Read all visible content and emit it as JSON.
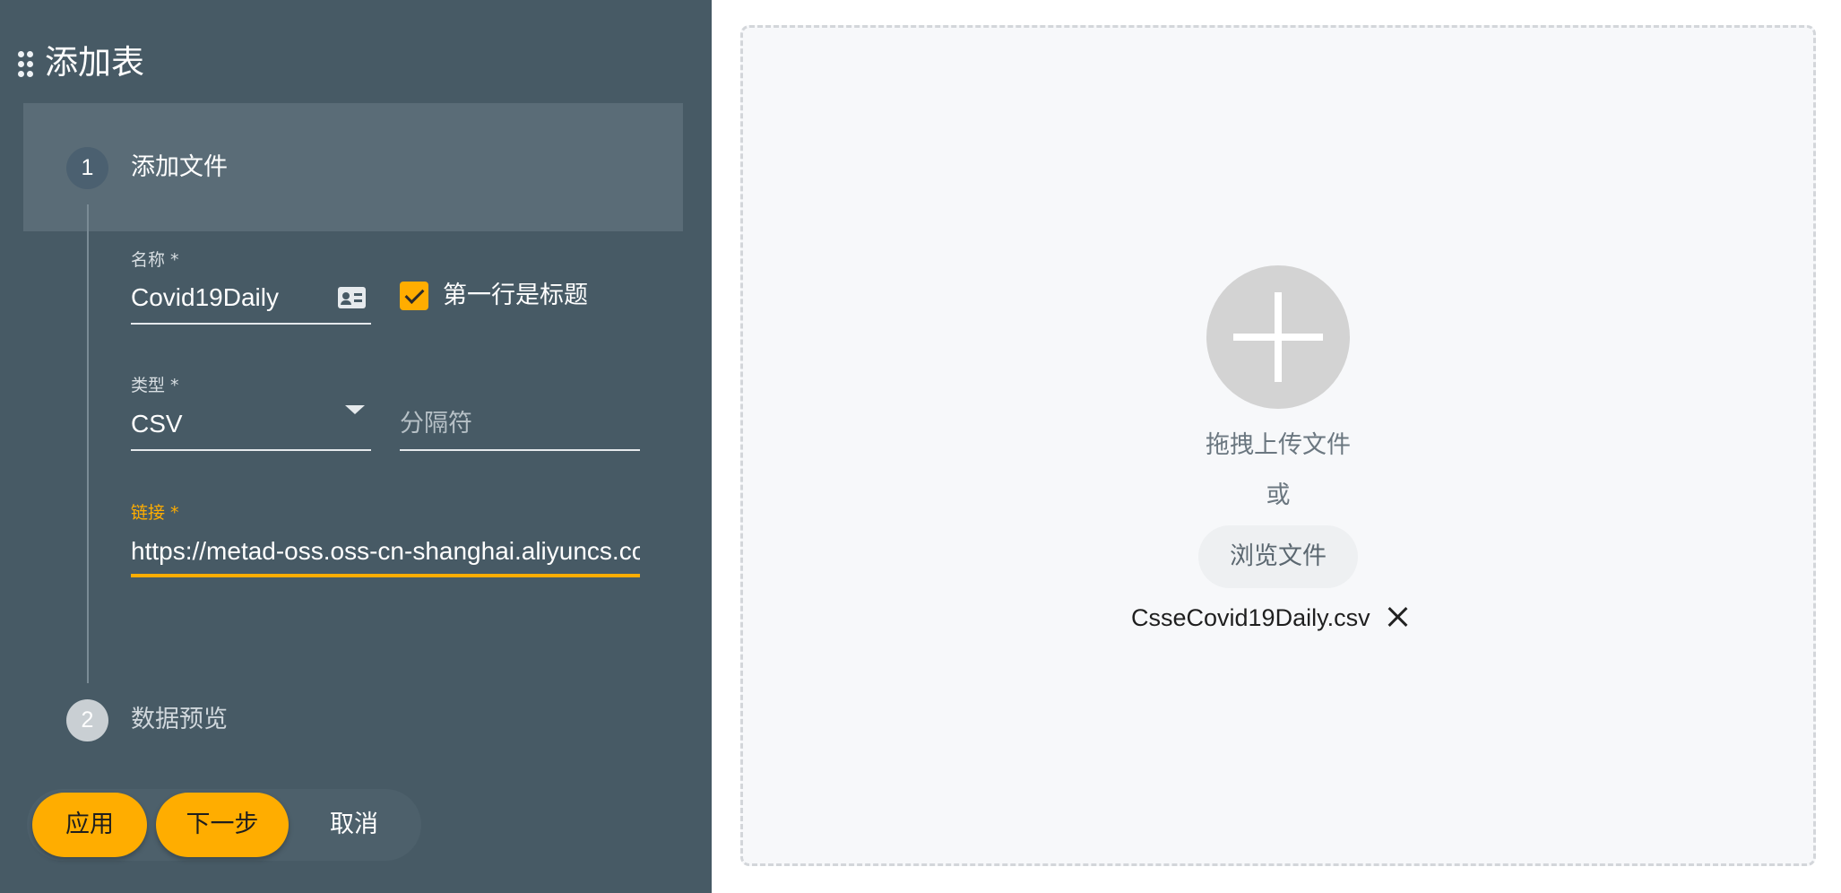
{
  "dialog": {
    "title": "添加表"
  },
  "steps": [
    {
      "number": "1",
      "label": "添加文件",
      "state": "active"
    },
    {
      "number": "2",
      "label": "数据预览",
      "state": "inactive"
    }
  ],
  "form": {
    "name": {
      "label": "名称 *",
      "value": "Covid19Daily",
      "icon": "contact-card-icon"
    },
    "first_row_header": {
      "label": "第一行是标题",
      "checked": true
    },
    "type": {
      "label": "类型 *",
      "value": "CSV"
    },
    "separator": {
      "placeholder": "分隔符",
      "value": ""
    },
    "link": {
      "label": "链接 *",
      "value": "https://metad-oss.oss-cn-shanghai.aliyuncs.com"
    }
  },
  "actions": {
    "apply": "应用",
    "next": "下一步",
    "cancel": "取消"
  },
  "upload": {
    "drop_text": "拖拽上传文件",
    "or_text": "或",
    "browse_label": "浏览文件",
    "file_name": "CsseCovid19Daily.csv"
  },
  "colors": {
    "panel": "#475a65",
    "accent": "#ffad00",
    "dropzone": "#f7f8fa"
  }
}
